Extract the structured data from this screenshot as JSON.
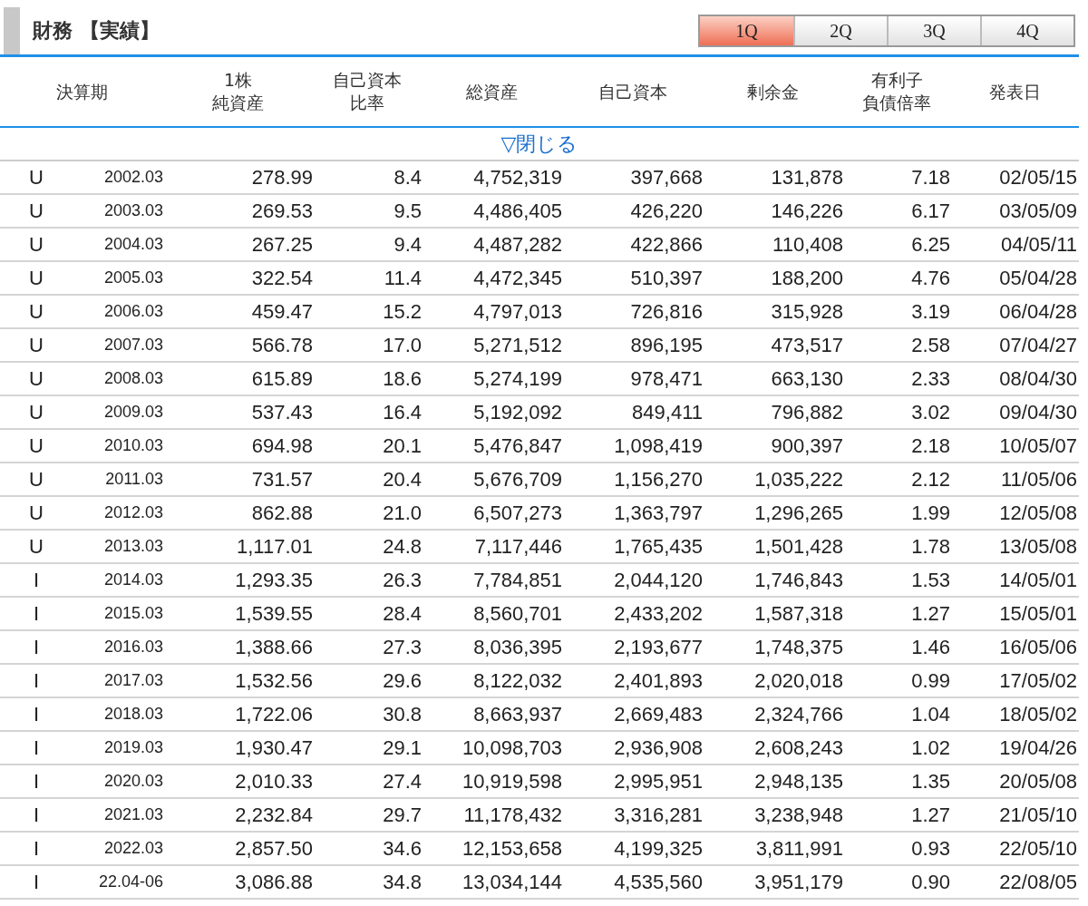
{
  "section": {
    "title": "財務 【実績】"
  },
  "quarter_tabs": [
    {
      "label": "1Q",
      "selected": true
    },
    {
      "label": "2Q",
      "selected": false
    },
    {
      "label": "3Q",
      "selected": false
    },
    {
      "label": "4Q",
      "selected": false
    }
  ],
  "table": {
    "columns": [
      {
        "lines": [
          "決算期"
        ]
      },
      {
        "lines": [
          "1株",
          "純資産"
        ]
      },
      {
        "lines": [
          "自己資本",
          "比率"
        ]
      },
      {
        "lines": [
          "総資産"
        ]
      },
      {
        "lines": [
          "自己資本"
        ]
      },
      {
        "lines": [
          "剰余金"
        ]
      },
      {
        "lines": [
          "有利子",
          "負債倍率"
        ]
      },
      {
        "lines": [
          "発表日"
        ]
      }
    ],
    "toggle": "▽閉じる",
    "rows": [
      {
        "type": "U",
        "cells": [
          "2002.03",
          "278.99",
          "8.4",
          "4,752,319",
          "397,668",
          "131,878",
          "7.18",
          "02/05/15"
        ]
      },
      {
        "type": "U",
        "cells": [
          "2003.03",
          "269.53",
          "9.5",
          "4,486,405",
          "426,220",
          "146,226",
          "6.17",
          "03/05/09"
        ]
      },
      {
        "type": "U",
        "cells": [
          "2004.03",
          "267.25",
          "9.4",
          "4,487,282",
          "422,866",
          "110,408",
          "6.25",
          "04/05/11"
        ]
      },
      {
        "type": "U",
        "cells": [
          "2005.03",
          "322.54",
          "11.4",
          "4,472,345",
          "510,397",
          "188,200",
          "4.76",
          "05/04/28"
        ]
      },
      {
        "type": "U",
        "cells": [
          "2006.03",
          "459.47",
          "15.2",
          "4,797,013",
          "726,816",
          "315,928",
          "3.19",
          "06/04/28"
        ]
      },
      {
        "type": "U",
        "cells": [
          "2007.03",
          "566.78",
          "17.0",
          "5,271,512",
          "896,195",
          "473,517",
          "2.58",
          "07/04/27"
        ]
      },
      {
        "type": "U",
        "cells": [
          "2008.03",
          "615.89",
          "18.6",
          "5,274,199",
          "978,471",
          "663,130",
          "2.33",
          "08/04/30"
        ]
      },
      {
        "type": "U",
        "cells": [
          "2009.03",
          "537.43",
          "16.4",
          "5,192,092",
          "849,411",
          "796,882",
          "3.02",
          "09/04/30"
        ]
      },
      {
        "type": "U",
        "cells": [
          "2010.03",
          "694.98",
          "20.1",
          "5,476,847",
          "1,098,419",
          "900,397",
          "2.18",
          "10/05/07"
        ]
      },
      {
        "type": "U",
        "cells": [
          "2011.03",
          "731.57",
          "20.4",
          "5,676,709",
          "1,156,270",
          "1,035,222",
          "2.12",
          "11/05/06"
        ]
      },
      {
        "type": "U",
        "cells": [
          "2012.03",
          "862.88",
          "21.0",
          "6,507,273",
          "1,363,797",
          "1,296,265",
          "1.99",
          "12/05/08"
        ]
      },
      {
        "type": "U",
        "cells": [
          "2013.03",
          "1,117.01",
          "24.8",
          "7,117,446",
          "1,765,435",
          "1,501,428",
          "1.78",
          "13/05/08"
        ]
      },
      {
        "type": "I",
        "cells": [
          "2014.03",
          "1,293.35",
          "26.3",
          "7,784,851",
          "2,044,120",
          "1,746,843",
          "1.53",
          "14/05/01"
        ]
      },
      {
        "type": "I",
        "cells": [
          "2015.03",
          "1,539.55",
          "28.4",
          "8,560,701",
          "2,433,202",
          "1,587,318",
          "1.27",
          "15/05/01"
        ]
      },
      {
        "type": "I",
        "cells": [
          "2016.03",
          "1,388.66",
          "27.3",
          "8,036,395",
          "2,193,677",
          "1,748,375",
          "1.46",
          "16/05/06"
        ]
      },
      {
        "type": "I",
        "cells": [
          "2017.03",
          "1,532.56",
          "29.6",
          "8,122,032",
          "2,401,893",
          "2,020,018",
          "0.99",
          "17/05/02"
        ]
      },
      {
        "type": "I",
        "cells": [
          "2018.03",
          "1,722.06",
          "30.8",
          "8,663,937",
          "2,669,483",
          "2,324,766",
          "1.04",
          "18/05/02"
        ]
      },
      {
        "type": "I",
        "cells": [
          "2019.03",
          "1,930.47",
          "29.1",
          "10,098,703",
          "2,936,908",
          "2,608,243",
          "1.02",
          "19/04/26"
        ]
      },
      {
        "type": "I",
        "cells": [
          "2020.03",
          "2,010.33",
          "27.4",
          "10,919,598",
          "2,995,951",
          "2,948,135",
          "1.35",
          "20/05/08"
        ]
      },
      {
        "type": "I",
        "cells": [
          "2021.03",
          "2,232.84",
          "29.7",
          "11,178,432",
          "3,316,281",
          "3,238,948",
          "1.27",
          "21/05/10"
        ]
      },
      {
        "type": "I",
        "cells": [
          "2022.03",
          "2,857.50",
          "34.6",
          "12,153,658",
          "4,199,325",
          "3,811,991",
          "0.93",
          "22/05/10"
        ]
      },
      {
        "type": "I",
        "cells": [
          "22.04-06",
          "3,086.88",
          "34.8",
          "13,034,144",
          "4,535,560",
          "3,951,179",
          "0.90",
          "22/08/05"
        ]
      }
    ]
  }
}
